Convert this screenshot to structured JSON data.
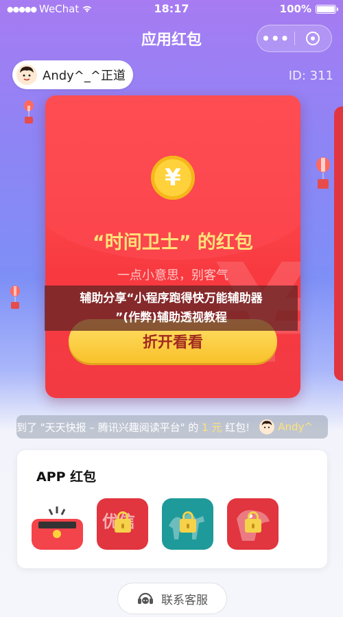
{
  "status_bar": {
    "carrier": "WeChat",
    "time": "18:17",
    "battery": "100%"
  },
  "nav": {
    "title": "应用红包"
  },
  "user": {
    "name": "Andy^_^正道",
    "id_label": "ID: 311"
  },
  "envelope": {
    "coin_symbol": "¥",
    "title": "“时间卫士” 的红包",
    "subtitle": "一点小意思，别客气",
    "open_button": "折开看看"
  },
  "overlay_caption": {
    "line1": "辅助分享“小程序跑得快万能辅助器",
    "line2": "”(作弊)辅助透视教程"
  },
  "marquee": {
    "prefix": "到了 \"天天快报 – 腾讯兴趣阅读平台\" 的 ",
    "amount": "1 元",
    "suffix": " 红包!",
    "user": "Andy^"
  },
  "app_section": {
    "title": "APP 红包",
    "apps": [
      {
        "name": "red-envelope-app",
        "color": "#f3434b",
        "locked": false
      },
      {
        "name": "youxin-app",
        "color": "#e1353f",
        "locked": true
      },
      {
        "name": "camel-app",
        "color": "#1f9a9a",
        "locked": true
      },
      {
        "name": "dog-app",
        "color": "#e1353f",
        "locked": true
      }
    ]
  },
  "service_button": {
    "label": "联系客服"
  }
}
